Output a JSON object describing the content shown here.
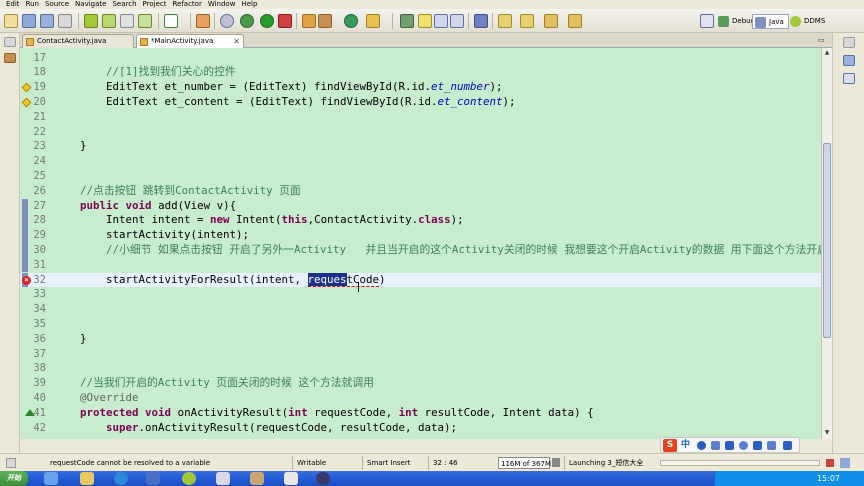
{
  "menubar": {
    "items": [
      "Edit",
      "Run",
      "Source",
      "Navigate",
      "Search",
      "Project",
      "Refactor",
      "Window",
      "Help"
    ]
  },
  "perspectives": {
    "debug": "Debug",
    "java": "Java",
    "ddms": "DDMS"
  },
  "tabs": [
    {
      "label": "ContactActivity.java",
      "active": false
    },
    {
      "label": "*MainActivity.java",
      "active": true
    }
  ],
  "editor": {
    "lines": [
      {
        "num": "17",
        "segments": []
      },
      {
        "num": "18",
        "segments": [
          {
            "t": "        "
          },
          {
            "t": "//[1]找到我们关心的控件",
            "c": "cm"
          }
        ]
      },
      {
        "num": "19",
        "segments": [
          {
            "t": "        EditText et_number = (EditText) findViewById(R.id."
          },
          {
            "t": "et_number",
            "c": "fld"
          },
          {
            "t": ");"
          }
        ],
        "marker": "warn"
      },
      {
        "num": "20",
        "segments": [
          {
            "t": "        EditText et_content = (EditText) findViewById(R.id."
          },
          {
            "t": "et_content",
            "c": "fld"
          },
          {
            "t": ");"
          }
        ],
        "marker": "warn"
      },
      {
        "num": "21",
        "segments": []
      },
      {
        "num": "22",
        "segments": []
      },
      {
        "num": "23",
        "segments": [
          {
            "t": "    }"
          }
        ]
      },
      {
        "num": "24",
        "segments": []
      },
      {
        "num": "25",
        "segments": []
      },
      {
        "num": "26",
        "segments": [
          {
            "t": "    "
          },
          {
            "t": "//点击按钮 跳转到ContactActivity 页面",
            "c": "cm"
          }
        ]
      },
      {
        "num": "27",
        "segments": [
          {
            "t": "    "
          },
          {
            "t": "public",
            "c": "kw"
          },
          {
            "t": " "
          },
          {
            "t": "void",
            "c": "kw"
          },
          {
            "t": " add(View v){"
          }
        ],
        "fold": true
      },
      {
        "num": "28",
        "segments": [
          {
            "t": "        Intent intent = "
          },
          {
            "t": "new",
            "c": "kw"
          },
          {
            "t": " Intent("
          },
          {
            "t": "this",
            "c": "kw"
          },
          {
            "t": ",ContactActivity."
          },
          {
            "t": "class",
            "c": "kw"
          },
          {
            "t": ");"
          }
        ],
        "fold": true
      },
      {
        "num": "29",
        "segments": [
          {
            "t": "        startActivity(intent);"
          }
        ],
        "fold": true
      },
      {
        "num": "30",
        "segments": [
          {
            "t": "        "
          },
          {
            "t": "//小细节 如果点击按钮 开启了另外一Activity   并且当开启的这个Activity关闭的时候 我想要这个开启Activity的数据 用下面这个方法开启acti",
            "c": "cm"
          }
        ],
        "fold": true
      },
      {
        "num": "31",
        "segments": [],
        "fold": true
      },
      {
        "num": "32",
        "segments": [
          {
            "t": "        startActivityForResult(intent, "
          },
          {
            "t": "requestCode",
            "c": "selerr"
          },
          {
            "t": ")"
          }
        ],
        "marker": "err",
        "current": true,
        "fold": true
      },
      {
        "num": "33",
        "segments": []
      },
      {
        "num": "34",
        "segments": []
      },
      {
        "num": "35",
        "segments": []
      },
      {
        "num": "36",
        "segments": [
          {
            "t": "    }"
          }
        ]
      },
      {
        "num": "37",
        "segments": []
      },
      {
        "num": "38",
        "segments": []
      },
      {
        "num": "39",
        "segments": [
          {
            "t": "    "
          },
          {
            "t": "//当我们开启的Activity 页面关闭的时候 这个方法就调用",
            "c": "cm"
          }
        ]
      },
      {
        "num": "40",
        "segments": [
          {
            "t": "    "
          },
          {
            "t": "@Override",
            "c": "ann"
          }
        ]
      },
      {
        "num": "41",
        "segments": [
          {
            "t": "    "
          },
          {
            "t": "protected",
            "c": "kw"
          },
          {
            "t": " "
          },
          {
            "t": "void",
            "c": "kw"
          },
          {
            "t": " onActivityResult("
          },
          {
            "t": "int",
            "c": "kw"
          },
          {
            "t": " requestCode, "
          },
          {
            "t": "int",
            "c": "kw"
          },
          {
            "t": " resultCode, Intent data) {"
          }
        ],
        "marker": "ovr"
      },
      {
        "num": "42",
        "segments": [
          {
            "t": "        "
          },
          {
            "t": "super",
            "c": "kw"
          },
          {
            "t": ".onActivityResult(requestCode, resultCode, data);"
          }
        ]
      }
    ]
  },
  "ime": {
    "label": "中"
  },
  "status": {
    "message": "requestCode cannot be resolved to a variable",
    "writable": "Writable",
    "insert_mode": "Smart Insert",
    "position": "32 : 46",
    "memory": "116M of 367M",
    "launching": "Launching 3_短信大全"
  },
  "taskbar": {
    "start": "开始",
    "clock": "15:07"
  },
  "colors": {
    "editor_bg": "#c7edcc",
    "keyword": "#7f0055",
    "comment": "#3f7f5f",
    "field": "#0000c0",
    "selection": "#1f2e8a"
  }
}
